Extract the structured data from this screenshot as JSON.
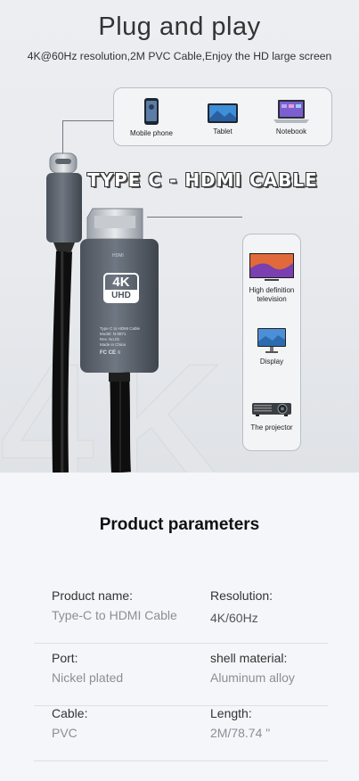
{
  "hero": {
    "title": "Plug and play",
    "subtitle": "4K@60Hz resolution,2M PVC Cable,Enjoy the HD large screen",
    "background_text": "4K",
    "cable_title": "TYPE C - HDMI CABLE",
    "badge_main": "4K",
    "badge_sub": "UHD",
    "hdmi_mark": "HDMI",
    "shell_text": [
      "Type C to HDMI Cable",
      "Model: N-0871",
      "Rev. No.01",
      "Made in China"
    ],
    "marks": [
      "FC",
      "CE",
      "≡"
    ]
  },
  "source_devices": [
    {
      "name": "phone-icon",
      "label": "Mobile phone"
    },
    {
      "name": "tablet-icon",
      "label": "Tablet"
    },
    {
      "name": "notebook-icon",
      "label": "Notebook"
    }
  ],
  "target_devices": [
    {
      "name": "tv-icon",
      "label": "High definition television"
    },
    {
      "name": "monitor-icon",
      "label": "Display"
    },
    {
      "name": "projector-icon",
      "label": "The projector"
    }
  ],
  "parameters": {
    "title": "Product parameters",
    "rows": [
      [
        {
          "key": "Product name:",
          "value": "Type-C to HDMI Cable"
        },
        {
          "key": "Resolution:",
          "value": "4K/60Hz"
        }
      ],
      [
        {
          "key": "Port:",
          "value": "Nickel plated"
        },
        {
          "key": "shell material:",
          "value": "Aluminum alloy"
        }
      ],
      [
        {
          "key": "Cable:",
          "value": "PVC"
        },
        {
          "key": "Length:",
          "value": "2M/78.74 \""
        }
      ]
    ]
  },
  "colors": {
    "shell": "#5a626c",
    "cable": "#1a1a1a",
    "accent_line": "#6e7680"
  }
}
